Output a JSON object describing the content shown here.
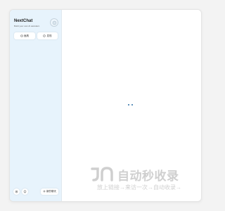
{
  "sidebar": {
    "title": "NextChat",
    "subtitle": "Build your own AI assistant.",
    "buttons": [
      {
        "label": "面具",
        "icon": "mask-icon"
      },
      {
        "label": "发现",
        "icon": "discover-icon"
      }
    ],
    "bottom": {
      "new_chat_label": "新的聊天",
      "icons": [
        "settings-icon",
        "github-icon"
      ]
    }
  },
  "main": {
    "state": "loading"
  },
  "watermark": {
    "logo_text": "自动秒收录",
    "sub_text": "放上链接→来访一次→自动收录→",
    "color": "#a9a9a9"
  },
  "colors": {
    "sidebar_bg": "#e7f3fc",
    "loading_dot": "#2b6ea6"
  }
}
